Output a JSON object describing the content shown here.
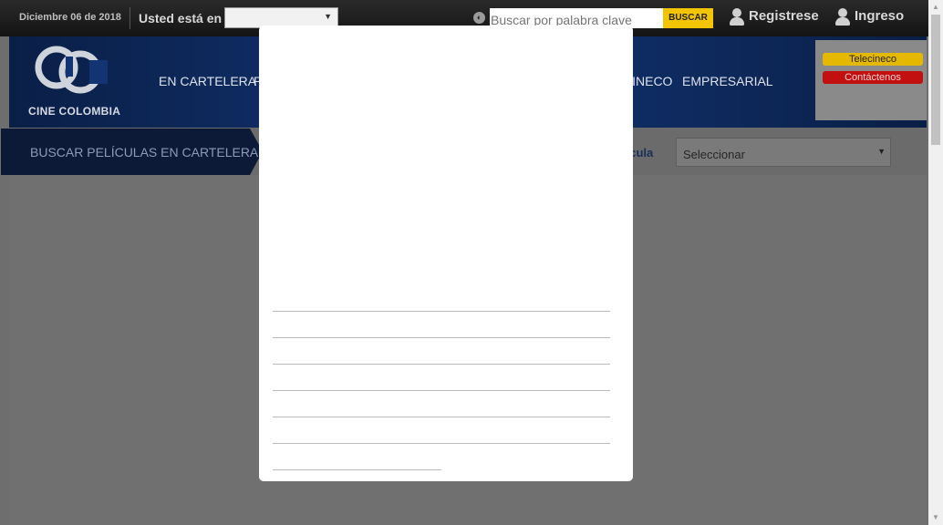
{
  "topbar": {
    "date": "Diciembre 06 de 2018",
    "location_label": "Usted está en",
    "location_value": "",
    "search_placeholder": "Buscar por palabra clave",
    "search_button": "BUSCAR",
    "register": "Registrese",
    "login": "Ingreso"
  },
  "header": {
    "brand": "CINE COLOMBIA",
    "nav": [
      "EN CARTELERA",
      "P",
      "CINECO",
      "EMPRESARIAL"
    ],
    "side_links": [
      "Telecineco",
      "Contáctenos"
    ]
  },
  "search_strip": {
    "label": "BUSCAR PELÍCULAS EN CARTELERA",
    "movie_label": "lícula",
    "movie_select": "Seleccionar"
  },
  "colors": {
    "accent_yellow": "#f2c500",
    "accent_red": "#d40000",
    "header_blue": "#123473"
  }
}
